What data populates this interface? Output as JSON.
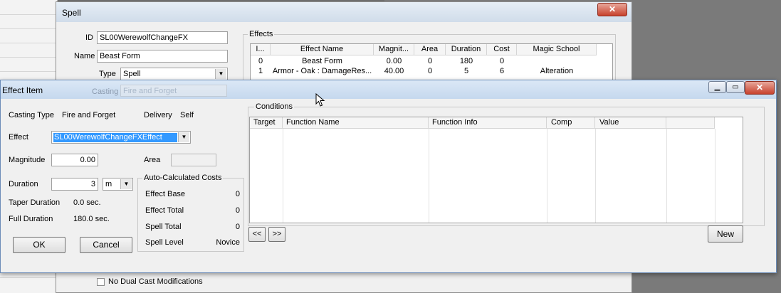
{
  "spell_window": {
    "title": "Spell",
    "close_label": "✕",
    "id_label": "ID",
    "id_value": "SL00WerewolfChangeFX",
    "name_label": "Name",
    "name_value": "Beast Form",
    "type_label": "Type",
    "type_value": "Spell",
    "casting_label": "Casting",
    "casting_value": "Fire and Forget",
    "effects_group": "Effects",
    "effects_columns": [
      "I...",
      "Effect Name",
      "Magnit...",
      "Area",
      "Duration",
      "Cost",
      "Magic School"
    ],
    "effects_rows": [
      [
        "0",
        "Beast Form",
        "0.00",
        "0",
        "180",
        "0",
        ""
      ],
      [
        "1",
        "Armor - Oak : DamageRes...",
        "40.00",
        "0",
        "5",
        "6",
        "Alteration"
      ]
    ],
    "no_dual_cast_label": "No Dual Cast Modifications"
  },
  "effect_window": {
    "title": "Effect Item",
    "casting_type_label": "Casting Type",
    "casting_type_value": "Fire and Forget",
    "delivery_label": "Delivery",
    "delivery_value": "Self",
    "effect_label": "Effect",
    "effect_value": "SL00WerewolfChangeFXEffect",
    "magnitude_label": "Magnitude",
    "magnitude_value": "0.00",
    "area_label": "Area",
    "area_value": "",
    "duration_label": "Duration",
    "duration_value": "3",
    "duration_unit": "m",
    "taper_duration_label": "Taper Duration",
    "taper_duration_value": "0.0 sec.",
    "full_duration_label": "Full Duration",
    "full_duration_value": "180.0 sec.",
    "ok_label": "OK",
    "cancel_label": "Cancel",
    "auto_costs_group": "Auto-Calculated Costs",
    "effect_base_label": "Effect Base",
    "effect_base_value": "0",
    "effect_total_label": "Effect Total",
    "effect_total_value": "0",
    "spell_total_label": "Spell Total",
    "spell_total_value": "0",
    "spell_level_label": "Spell Level",
    "spell_level_value": "Novice",
    "conditions_group": "Conditions",
    "conditions_columns": [
      "Target",
      "Function Name",
      "Function Info",
      "Comp",
      "Value"
    ],
    "prev_label": "<<",
    "next_label": ">>",
    "new_label": "New",
    "minimize_icon": "minimize-icon",
    "maximize_icon": "maximize-icon",
    "close_icon": "close-icon",
    "close_label": "✕"
  }
}
